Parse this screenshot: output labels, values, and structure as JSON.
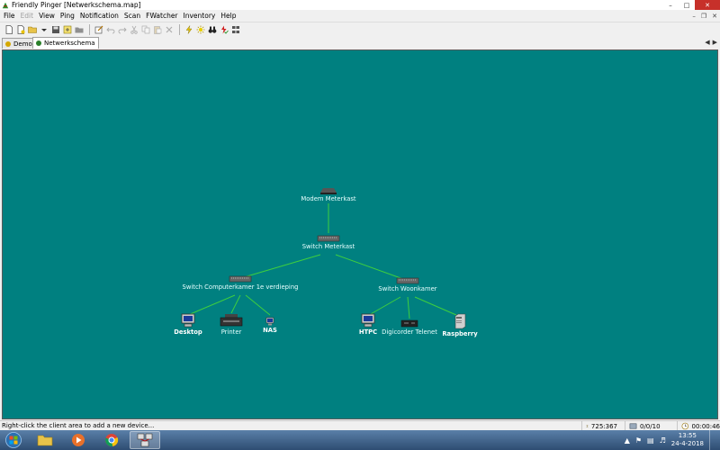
{
  "window": {
    "title": "Friendly Pinger [Netwerkschema.map]"
  },
  "menu": [
    {
      "label": "File",
      "disabled": false
    },
    {
      "label": "Edit",
      "disabled": true
    },
    {
      "label": "View",
      "disabled": false
    },
    {
      "label": "Ping",
      "disabled": false
    },
    {
      "label": "Notification",
      "disabled": false
    },
    {
      "label": "Scan",
      "disabled": false
    },
    {
      "label": "FWatcher",
      "disabled": false
    },
    {
      "label": "Inventory",
      "disabled": false
    },
    {
      "label": "Help",
      "disabled": false
    }
  ],
  "tabs": [
    {
      "label": "Demo",
      "active": false
    },
    {
      "label": "Netwerkschema",
      "active": true
    }
  ],
  "map": {
    "background": "#008080",
    "link_color": "#3ecf3e",
    "nodes": {
      "modem": {
        "label": "Modem Meterkast",
        "icon": "modem-icon"
      },
      "switch_main": {
        "label": "Switch Meterkast",
        "icon": "switch-icon"
      },
      "switch_comp": {
        "label": "Switch Computerkamer 1e verdieping",
        "icon": "switch-icon"
      },
      "switch_woon": {
        "label": "Switch Woonkamer",
        "icon": "switch-icon"
      },
      "desktop": {
        "label": "Desktop",
        "icon": "monitor-icon"
      },
      "printer": {
        "label": "Printer",
        "icon": "printer-icon"
      },
      "nas": {
        "label": "NAS",
        "icon": "small-monitor-icon"
      },
      "htpc": {
        "label": "HTPC",
        "icon": "monitor-icon"
      },
      "digicorder": {
        "label": "Digicorder Telenet",
        "icon": "settop-box-icon"
      },
      "raspberry": {
        "label": "Raspberry",
        "icon": "server-tower-icon"
      }
    }
  },
  "status": {
    "hint": "Right-click the client area to add a new device...",
    "coords": "725:367",
    "counts": "0/0/10",
    "timer": "00:00:46"
  },
  "taskbar": {
    "time": "13:55",
    "date": "24-4-2018"
  }
}
